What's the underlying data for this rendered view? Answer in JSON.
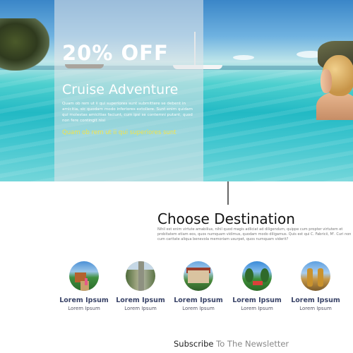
{
  "hero": {
    "offer": "20% OFF",
    "title": "Cruise Adventure",
    "body": "Quam ob rem ut ii qui superiores sunt submittere se debent in amicitia, sic quodam modo inferiores extollere. Sunt enim quidam qui molestas amicitias faciunt, cum ipsi se contemni putant; quod non fere contingit nisi",
    "highlight": "Quam ob rem ut ii qui superiores sunt"
  },
  "destination": {
    "title": "Choose Destination",
    "body": "Nihil est enim virtute amabilius, nihil quod magis adliciat ad diligendum, quippe cum propter virtutem et probitatem etiam eos, quos numquam vidimus, quodam modo diligamus. Quis est qui C. Fabricii, M'. Curi non cum caritate aliqua benevola memoriam usurpet, quos numquam viderit?",
    "cards": [
      {
        "title": "Lorem Ipsum",
        "subtitle": "Lorem Ipsum"
      },
      {
        "title": "Lorem Ipsum",
        "subtitle": "Lorem Ipsum"
      },
      {
        "title": "Lorem Ipsum",
        "subtitle": "Lorem Ipsum"
      },
      {
        "title": "Lorem Ipsum",
        "subtitle": "Lorem Ipsum"
      },
      {
        "title": "Lorem Ipsum",
        "subtitle": "Lorem Ipsum"
      }
    ]
  },
  "newsletter": {
    "label_strong": "Subscribe",
    "label_muted": "To The Newsletter"
  },
  "colors": {
    "accent_yellow": "#f2e54a",
    "card_title": "#3a4468",
    "overlay": "#e1e5e9"
  }
}
